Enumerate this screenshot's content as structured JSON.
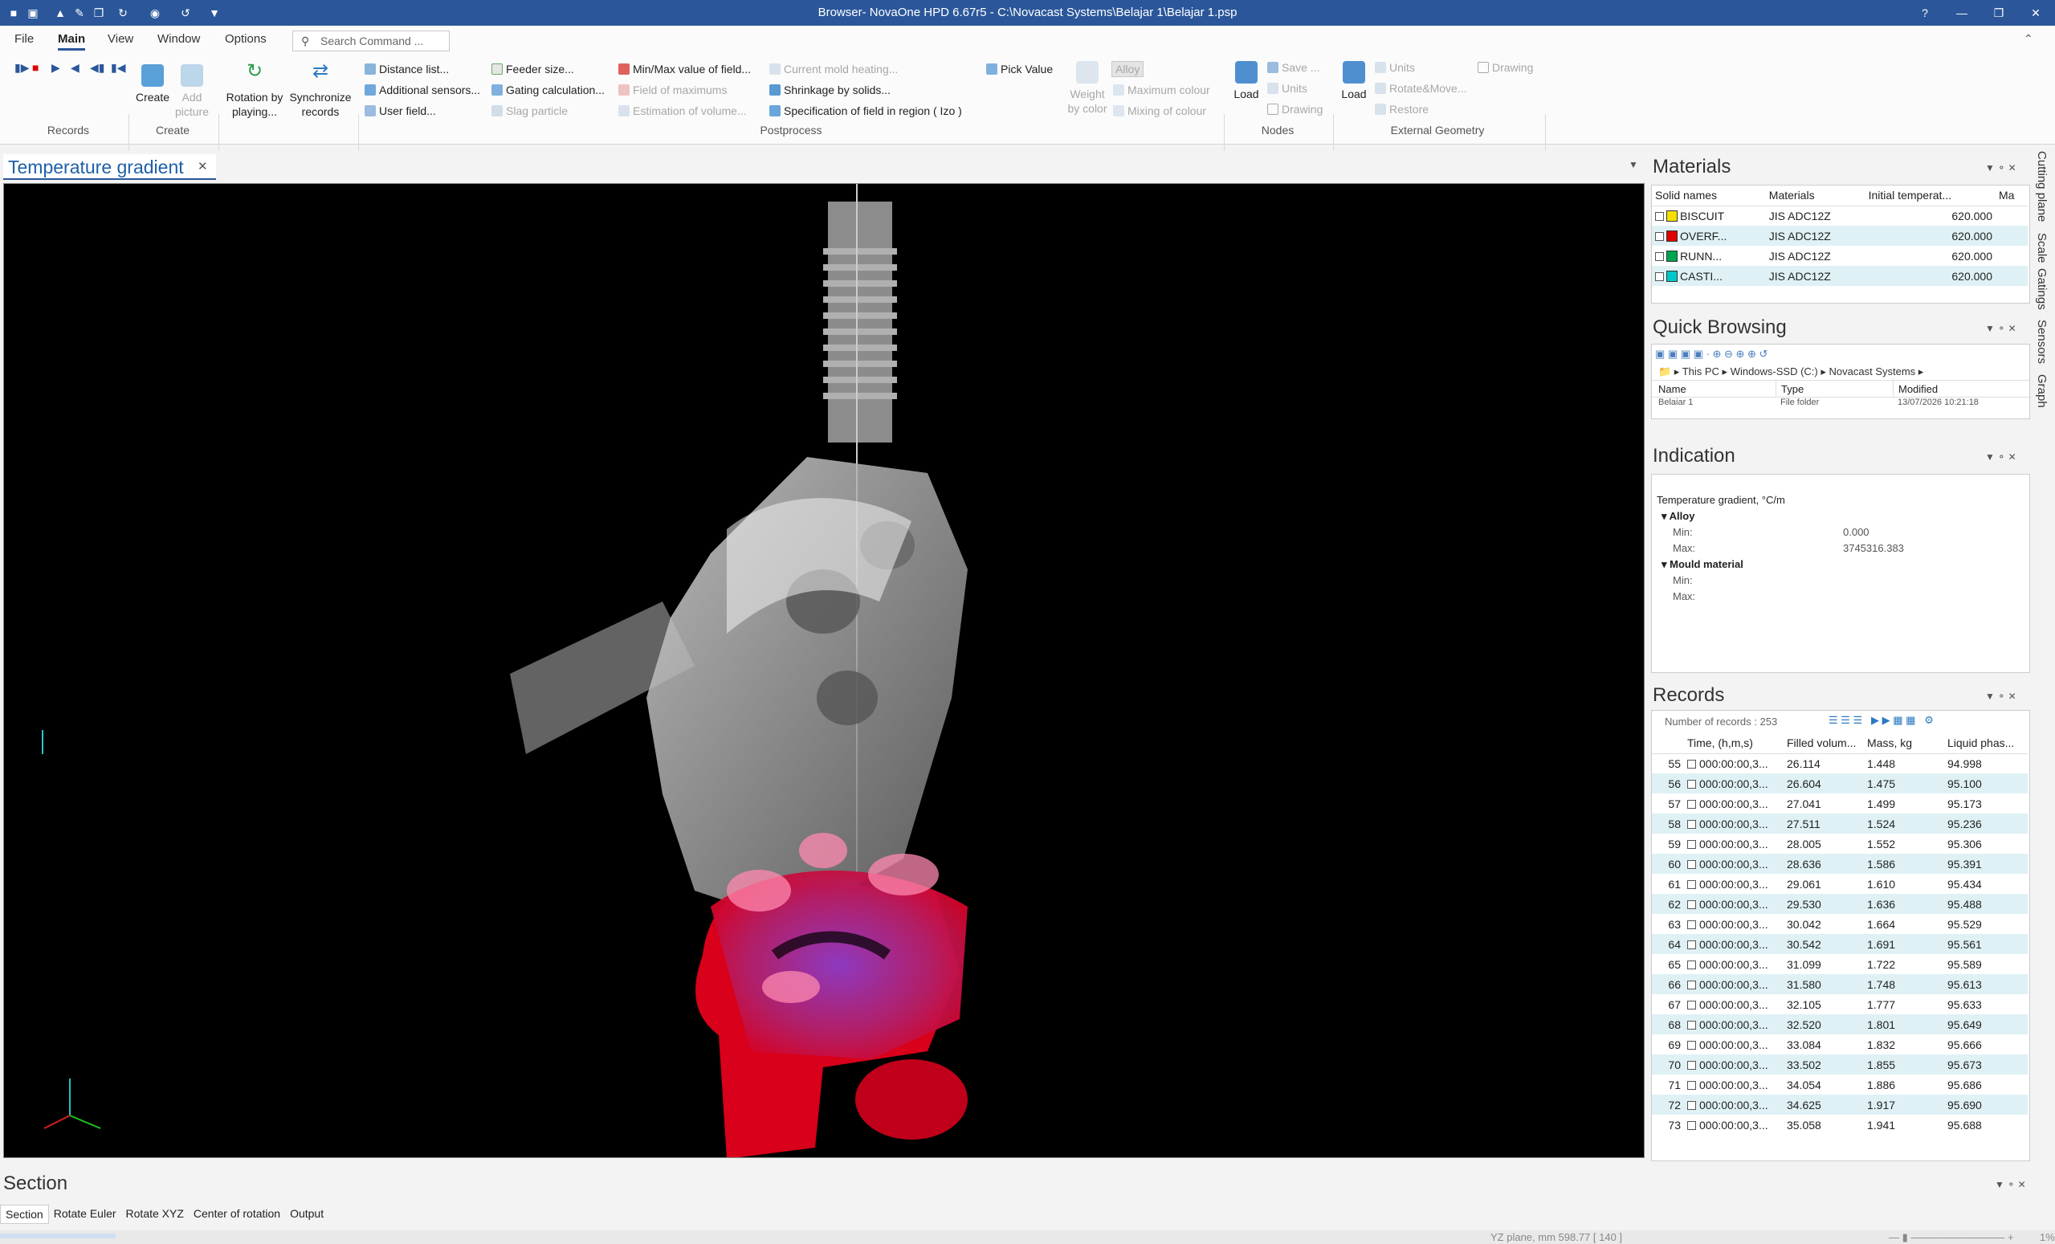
{
  "window": {
    "title": "Browser- NovaOne HPD  6.67r5 - C:\\Novacast Systems\\Belajar 1\\Belajar 1.psp"
  },
  "quick_access": [
    "qa-save",
    "qa-new",
    "qa-open",
    "qa-tools",
    "qa-copy",
    "qa-rotate",
    "qa-sensor",
    "qa-export",
    "qa-dropdown"
  ],
  "menu": {
    "items": [
      "File",
      "Main",
      "View",
      "Window",
      "Options"
    ],
    "search_placeholder": "Search Command ..."
  },
  "ribbon": {
    "records_group": "Records",
    "create_group": "Create",
    "postprocess_group": "Postprocess",
    "nodes_group": "Nodes",
    "extgeo_group": "External Geometry",
    "create": "Create",
    "add_picture": "Add picture",
    "rotation": "Rotation by playing...",
    "synchronize": "Synchronize records",
    "distance": "Distance list...",
    "additional_sensors": "Additional sensors...",
    "user_field": "User field...",
    "feeder_size": "Feeder size...",
    "gating_calc": "Gating calculation...",
    "slag_particle": "Slag particle",
    "minmax": "Min/Max value of field...",
    "field_max": "Field of maximums",
    "estimation": "Estimation of volume...",
    "current_mold": "Current mold heating...",
    "shrinkage": "Shrinkage by solids...",
    "specification": "Specification of field in region ( Izo )",
    "pick_value": "Pick Value",
    "weight_color": "Weight by color",
    "alloy": "Alloy",
    "max_colour": "Maximum colour",
    "mixing_colour": "Mixing of colour",
    "load_nodes": "Load",
    "save_nodes": "Save ...",
    "units_nodes": "Units",
    "drawing_nodes": "Drawing",
    "load_ext": "Load",
    "units_ext": "Units",
    "rotate_move": "Rotate&Move...",
    "restore": "Restore",
    "drawing_ext": "Drawing"
  },
  "doc_tab": {
    "label": "Temperature gradient"
  },
  "materials": {
    "title": "Materials",
    "headers": [
      "Solid names",
      "Materials",
      "Initial temperat...",
      "Ma"
    ],
    "rows": [
      {
        "name": "BISCUIT",
        "color": "#f5e000",
        "material": "JIS ADC12Z",
        "temp": "620.000"
      },
      {
        "name": "OVERF...",
        "color": "#e00000",
        "material": "JIS ADC12Z",
        "temp": "620.000"
      },
      {
        "name": "RUNN...",
        "color": "#00a651",
        "material": "JIS ADC12Z",
        "temp": "620.000"
      },
      {
        "name": "CASTI...",
        "color": "#00c8c8",
        "material": "JIS ADC12Z",
        "temp": "620.000"
      }
    ]
  },
  "quick_browsing": {
    "title": "Quick Browsing",
    "path": [
      "This PC",
      "Windows-SSD (C:)",
      "Novacast Systems"
    ],
    "headers": [
      "Name",
      "Type",
      "Modified"
    ],
    "row": {
      "name": "Belajar 1",
      "type": "File folder",
      "modified": "13/07/2026 10:21:18"
    }
  },
  "indication": {
    "title": "Indication",
    "field": "Temperature gradient, °C/m",
    "alloy_label": "Alloy",
    "min_label": "Min:",
    "max_label": "Max:",
    "alloy_min": "0.000",
    "alloy_max": "3745316.383",
    "mould_label": "Mould material"
  },
  "records": {
    "title": "Records",
    "count_label": "Number of records : 253",
    "headers": [
      "Time, (h,m,s)",
      "Filled volum...",
      "Mass, kg",
      "Liquid phas..."
    ],
    "rows": [
      {
        "n": "55",
        "t": "000:00:00,3...",
        "f": "26.114",
        "m": "1.448",
        "l": "94.998"
      },
      {
        "n": "56",
        "t": "000:00:00,3...",
        "f": "26.604",
        "m": "1.475",
        "l": "95.100"
      },
      {
        "n": "57",
        "t": "000:00:00,3...",
        "f": "27.041",
        "m": "1.499",
        "l": "95.173"
      },
      {
        "n": "58",
        "t": "000:00:00,3...",
        "f": "27.511",
        "m": "1.524",
        "l": "95.236"
      },
      {
        "n": "59",
        "t": "000:00:00,3...",
        "f": "28.005",
        "m": "1.552",
        "l": "95.306"
      },
      {
        "n": "60",
        "t": "000:00:00,3...",
        "f": "28.636",
        "m": "1.586",
        "l": "95.391"
      },
      {
        "n": "61",
        "t": "000:00:00,3...",
        "f": "29.061",
        "m": "1.610",
        "l": "95.434"
      },
      {
        "n": "62",
        "t": "000:00:00,3...",
        "f": "29.530",
        "m": "1.636",
        "l": "95.488"
      },
      {
        "n": "63",
        "t": "000:00:00,3...",
        "f": "30.042",
        "m": "1.664",
        "l": "95.529"
      },
      {
        "n": "64",
        "t": "000:00:00,3...",
        "f": "30.542",
        "m": "1.691",
        "l": "95.561"
      },
      {
        "n": "65",
        "t": "000:00:00,3...",
        "f": "31.099",
        "m": "1.722",
        "l": "95.589"
      },
      {
        "n": "66",
        "t": "000:00:00,3...",
        "f": "31.580",
        "m": "1.748",
        "l": "95.613"
      },
      {
        "n": "67",
        "t": "000:00:00,3...",
        "f": "32.105",
        "m": "1.777",
        "l": "95.633"
      },
      {
        "n": "68",
        "t": "000:00:00,3...",
        "f": "32.520",
        "m": "1.801",
        "l": "95.649"
      },
      {
        "n": "69",
        "t": "000:00:00,3...",
        "f": "33.084",
        "m": "1.832",
        "l": "95.666"
      },
      {
        "n": "70",
        "t": "000:00:00,3...",
        "f": "33.502",
        "m": "1.855",
        "l": "95.673"
      },
      {
        "n": "71",
        "t": "000:00:00,3...",
        "f": "34.054",
        "m": "1.886",
        "l": "95.686"
      },
      {
        "n": "72",
        "t": "000:00:00,3...",
        "f": "34.625",
        "m": "1.917",
        "l": "95.690"
      },
      {
        "n": "73",
        "t": "000:00:00,3...",
        "f": "35.058",
        "m": "1.941",
        "l": "95.688"
      }
    ]
  },
  "side_tabs": [
    "Cutting plane",
    "Scale",
    "Gatings",
    "Sensors",
    "Graph"
  ],
  "section": {
    "title": "Section",
    "tabs": [
      "Section",
      "Rotate Euler",
      "Rotate XYZ",
      "Center of rotation",
      "Output"
    ]
  },
  "status": {
    "plane": "YZ plane, mm  598.77  [ 140 ]",
    "zoom": "1%"
  },
  "colors": {
    "accent": "#2b579a",
    "selected_row": "#dff1f5"
  }
}
